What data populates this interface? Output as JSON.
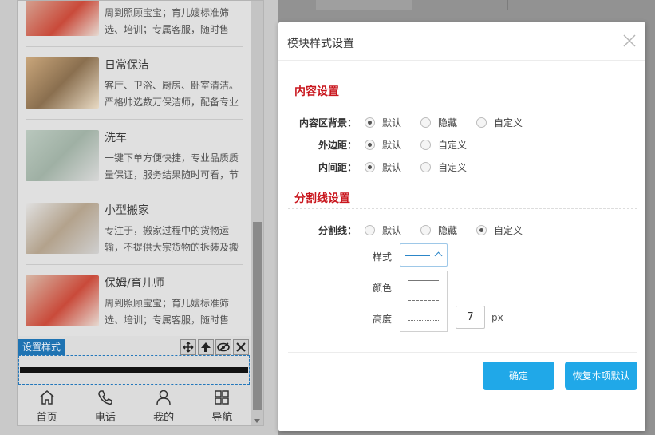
{
  "phone": {
    "items": [
      {
        "title": "",
        "desc": "周到照顾宝宝；育儿嫂标准筛选、培训；专属客服，随时售"
      },
      {
        "title": "日常保洁",
        "desc": "客厅、卫浴、厨房、卧室清洁。严格帅选数万保洁师，配备专业"
      },
      {
        "title": "洗车",
        "desc": "一键下单方便快捷，专业品质质量保证，服务结果随时可看，节"
      },
      {
        "title": "小型搬家",
        "desc": "专注于，搬家过程中的货物运输，不提供大宗货物的拆装及搬"
      },
      {
        "title": "保姆/育儿师",
        "desc": "周到照顾宝宝；育儿嫂标准筛选、培训；专属客服，随时售"
      }
    ],
    "style_tag": "设置样式",
    "tabs": [
      {
        "label": "首页",
        "icon": "home-icon"
      },
      {
        "label": "电话",
        "icon": "phone-icon"
      },
      {
        "label": "我的",
        "icon": "user-icon"
      },
      {
        "label": "导航",
        "icon": "grid-icon"
      }
    ]
  },
  "modal": {
    "title": "模块样式设置",
    "content_section": "内容设置",
    "content_bg_label": "内容区背景：",
    "content_bg_options": [
      "默认",
      "隐藏",
      "自定义"
    ],
    "content_bg_selected": "默认",
    "margin_label": "外边距：",
    "margin_options": [
      "默认",
      "自定义"
    ],
    "margin_selected": "默认",
    "padding_label": "内间距：",
    "padding_options": [
      "默认",
      "自定义"
    ],
    "padding_selected": "默认",
    "divider_section": "分割线设置",
    "divider_label": "分割线：",
    "divider_options": [
      "默认",
      "隐藏",
      "自定义"
    ],
    "divider_selected": "自定义",
    "style_label": "样式",
    "color_label": "颜色",
    "height_label": "高度",
    "height_value": "7",
    "height_unit": "px",
    "confirm_label": "确定",
    "reset_label": "恢复本项默认"
  },
  "colors": {
    "accent": "#20a8e8",
    "section_title": "#c9171e",
    "style_tag_bg": "#1f73b2"
  }
}
